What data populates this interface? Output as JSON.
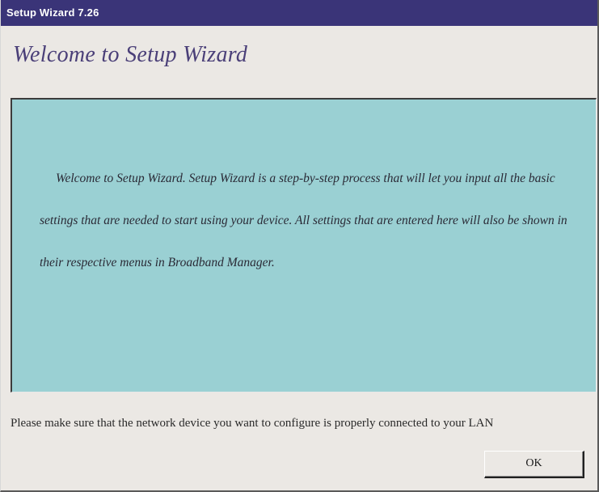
{
  "window": {
    "title": "Setup Wizard 7.26"
  },
  "header": {
    "title": "Welcome to Setup Wizard"
  },
  "main": {
    "intro_text": "Welcome to Setup Wizard. Setup Wizard is a step-by-step process that will let you input all the basic settings that are needed to start using your device. All settings that are entered here will also be shown in their respective menus in Broadband Manager."
  },
  "footer": {
    "notice": "Please make sure that the network device you want to configure is properly connected to your LAN",
    "ok_label": "OK"
  },
  "colors": {
    "titlebar": "#3a3478",
    "heading": "#4a3f78",
    "panel": "#9ad0d3",
    "window_bg": "#ebe8e4"
  }
}
